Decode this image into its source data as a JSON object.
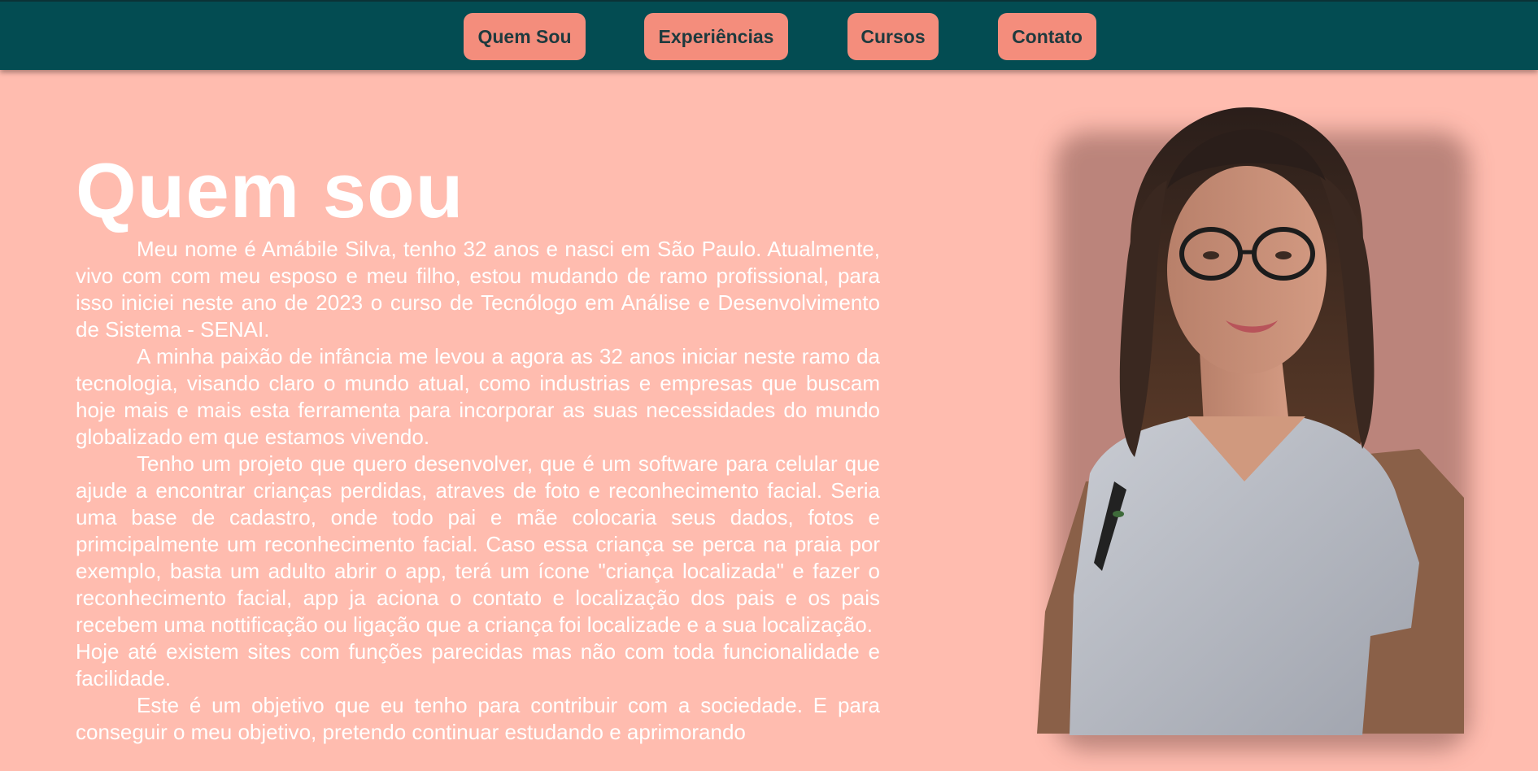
{
  "nav": {
    "items": [
      {
        "label": "Quem Sou"
      },
      {
        "label": "Experiências"
      },
      {
        "label": "Cursos"
      },
      {
        "label": "Contato"
      }
    ]
  },
  "main": {
    "title": "Quem sou",
    "paragraphs": [
      "Meu nome é Amábile Silva, tenho 32 anos e nasci em São Paulo. Atualmente, vivo com com meu esposo e meu filho, estou mudando de ramo profissional, para isso iniciei neste ano de 2023 o curso de Tecnólogo em Análise e Desenvolvimento de Sistema - SENAI.",
      "A minha paixão de infância me levou a agora as 32 anos iniciar neste ramo da tecnologia, visando claro o mundo atual, como industrias e empresas que buscam hoje mais e mais esta ferramenta para incorporar as suas necessidades do mundo globalizado em que estamos vivendo.",
      "Tenho um projeto que quero desenvolver, que é um software para celular que ajude a encontrar crianças perdidas, atraves de foto e reconhecimento facial. Seria uma base de cadastro, onde todo pai e mãe colocaria seus dados, fotos e primcipalmente um reconhecimento facial. Caso essa criança se perca na praia por exemplo, basta um adulto abrir o app, terá um ícone \"criança localizada\" e fazer o reconhecimento facial, app ja aciona o contato e localização dos pais e os pais recebem uma nottificação ou ligação que a criança foi localizade e a sua localização.",
      "Hoje até existem sites com funções parecidas mas não com toda funcionalidade e facilidade.",
      "Este é um objetivo que eu tenho para contribuir com a sociedade. E para conseguir o meu objetivo, pretendo continuar estudando e aprimorando"
    ]
  },
  "colors": {
    "nav_bg": "#034c52",
    "nav_button": "#f48d7c",
    "page_bg": "#ffbcaf",
    "text": "#ffffff"
  }
}
